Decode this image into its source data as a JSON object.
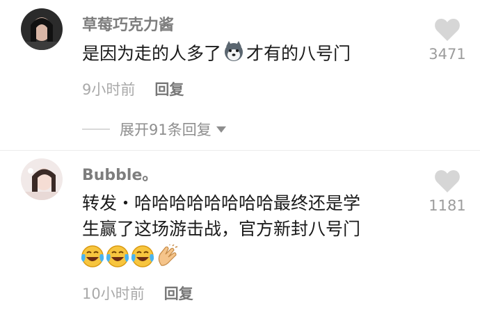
{
  "comments": [
    {
      "username": "草莓巧克力酱",
      "text_before": "是因为走的人多了",
      "text_after": "才有的八号门",
      "inline_emoji": "husky-emoji",
      "time": "9小时前",
      "reply_label": "回复",
      "likes": "3471"
    },
    {
      "username": "Bubble。",
      "line1": "转发・哈哈哈哈哈哈哈哈最终还是学",
      "line2": "生赢了这场游击战，官方新封八号门",
      "emojis": [
        "laugh-cry-emoji",
        "laugh-cry-emoji",
        "laugh-cry-emoji",
        "clap-emoji"
      ],
      "time": "10小时前",
      "reply_label": "回复",
      "likes": "1181"
    }
  ],
  "expand_replies": {
    "label": "展开91条回复",
    "icon": "caret-down-icon"
  },
  "colors": {
    "username": "#7d7d7d",
    "text": "#1a1a1a",
    "meta": "#a9a9a9",
    "heart": "#d6d6d6"
  }
}
